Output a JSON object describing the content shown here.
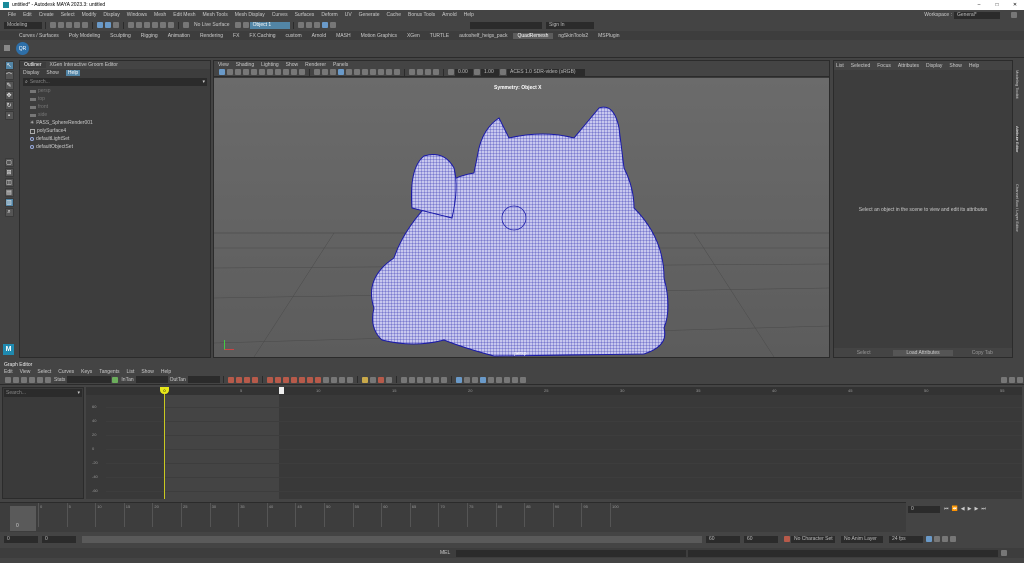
{
  "window": {
    "title": "untitled* - Autodesk MAYA 2023.3: untitled",
    "workspace_label": "Workspace :",
    "workspace_value": "General*"
  },
  "menubar": [
    "File",
    "Edit",
    "Create",
    "Select",
    "Modify",
    "Display",
    "Windows",
    "Mesh",
    "Edit Mesh",
    "Mesh Tools",
    "Mesh Display",
    "Curves",
    "Surfaces",
    "Deform",
    "UV",
    "Generate",
    "Cache",
    "Bonus Tools",
    "Arnold",
    "Help"
  ],
  "statusline": {
    "mode": "Modeling",
    "live_surface": "No Live Surface",
    "object_field": "Object 1",
    "sign_in": "Sign In"
  },
  "shelf_tabs": [
    "Curves / Surfaces",
    "Poly Modeling",
    "Sculpting",
    "Rigging",
    "Animation",
    "Rendering",
    "FX",
    "FX Caching",
    "custom",
    "Arnold",
    "MASH",
    "Motion Graphics",
    "XGen",
    "TURTLE",
    "autoshelf_heigs_pack",
    "QuadRemesh",
    "ngSkinTools2",
    "MSPlugin"
  ],
  "active_shelf": "QuadRemesh",
  "outliner": {
    "tabs": [
      "Outliner",
      "XGen Interactive Groom Editor"
    ],
    "menu": [
      "Display",
      "Show",
      "Help"
    ],
    "search": "Search...",
    "items": [
      "persp",
      "top",
      "front",
      "side",
      "PASS_SphereRender001",
      "polySurface4",
      "defaultLightSet",
      "defaultObjectSet"
    ]
  },
  "viewport": {
    "menu": [
      "View",
      "Shading",
      "Lighting",
      "Show",
      "Renderer",
      "Panels"
    ],
    "symmetry": "Symmetry: Object X",
    "camera": "persp",
    "field1": "0.00",
    "field2": "1.00",
    "colorspace": "ACES 1.0 SDR-video (sRGB)"
  },
  "attribute_editor": {
    "menu": [
      "List",
      "Selected",
      "Focus",
      "Attributes",
      "Display",
      "Show",
      "Help"
    ],
    "message": "Select an object in the scene to view and edit its attributes",
    "buttons": [
      "Select",
      "Load Attributes",
      "Copy Tab"
    ],
    "side_tabs": [
      "Modeling Toolkit",
      "Attribute Editor",
      "Channel Box / Layer Editor"
    ]
  },
  "graph_editor": {
    "title": "Graph Editor",
    "menu": [
      "Edit",
      "View",
      "Select",
      "Curves",
      "Keys",
      "Tangents",
      "List",
      "Show",
      "Help"
    ],
    "stats_label": "Stats",
    "infan_label": "InTan",
    "outtan_label": "OutTan",
    "search": "Search...",
    "top_ticks": [
      "0",
      "5",
      "10",
      "15",
      "20",
      "25",
      "30",
      "35",
      "40",
      "45",
      "50",
      "55",
      "60",
      "65"
    ],
    "y_ticks": [
      "60",
      "40",
      "20",
      "0",
      "-20",
      "-40",
      "-60"
    ],
    "current_frame": "0"
  },
  "timeslider": {
    "ticks": [
      "0",
      "5",
      "10",
      "15",
      "20",
      "25",
      "30",
      "35",
      "40",
      "45",
      "50",
      "55",
      "60",
      "65",
      "70",
      "75",
      "80",
      "85",
      "90",
      "95",
      "100"
    ],
    "current_frame": "0",
    "frame_field": "0"
  },
  "rangeslider": {
    "start": "0",
    "start2": "0",
    "end": "60",
    "end2": "60",
    "character_set": "No Character Set",
    "anim_layer": "No Anim Layer",
    "fps": "24 fps"
  },
  "commandline": {
    "lang": "MEL"
  },
  "colors": {
    "mesh": "#1a1aa8",
    "selected": "#5285a6",
    "timeline_marker": "#c9c920"
  }
}
